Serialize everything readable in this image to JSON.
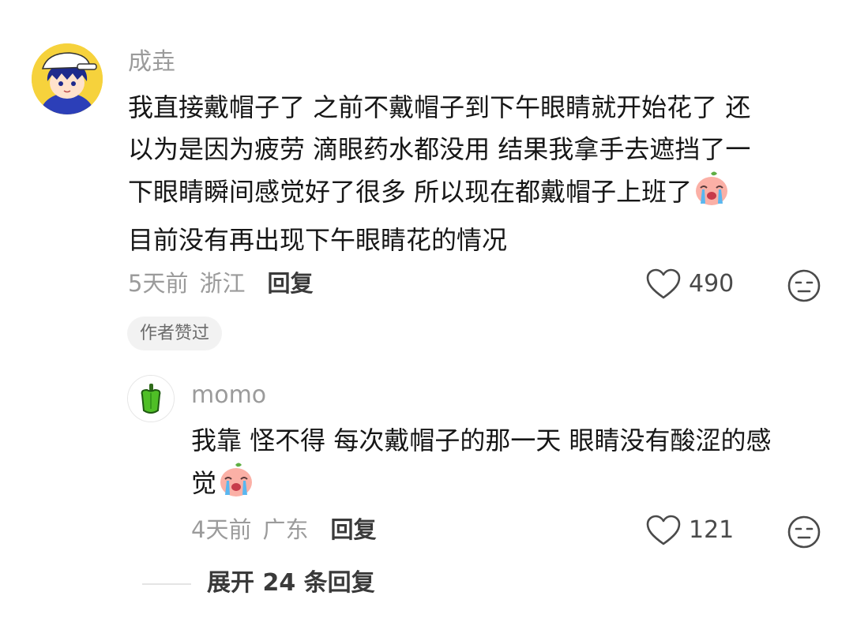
{
  "comment": {
    "username": "成垚",
    "text_lines": [
      "我直接戴帽子了  之前不戴帽子到下午眼睛就开始花了  还",
      "以为是因为疲劳  滴眼药水都没用  结果我拿手去遮挡了一",
      "下眼睛瞬间感觉好了很多  所以现在都戴帽子上班了",
      "目前没有再出现下午眼睛花的情况"
    ],
    "time": "5天前",
    "location": "浙江",
    "reply_label": "回复",
    "like_count": "490",
    "author_badge": "作者赞过",
    "icons": [
      "avatar-boy-cap",
      "crying-emoji",
      "heart-icon",
      "neutral-face-icon"
    ]
  },
  "reply": {
    "username": "momo",
    "text_lines": [
      "我靠  怪不得  每次戴帽子的那一天  眼睛没有酸涩的感",
      "觉"
    ],
    "time": "4天前",
    "location": "广东",
    "reply_label": "回复",
    "like_count": "121",
    "icons": [
      "avatar-green-pepper",
      "crying-emoji",
      "heart-icon",
      "neutral-face-icon"
    ]
  },
  "expand_label": "展开 24 条回复",
  "colors": {
    "text": "#161616",
    "muted": "#9b9b9b",
    "avatar_bg": "#f6d23c",
    "badge_bg": "#f2f2f2",
    "pepper": "#4fbf26"
  }
}
